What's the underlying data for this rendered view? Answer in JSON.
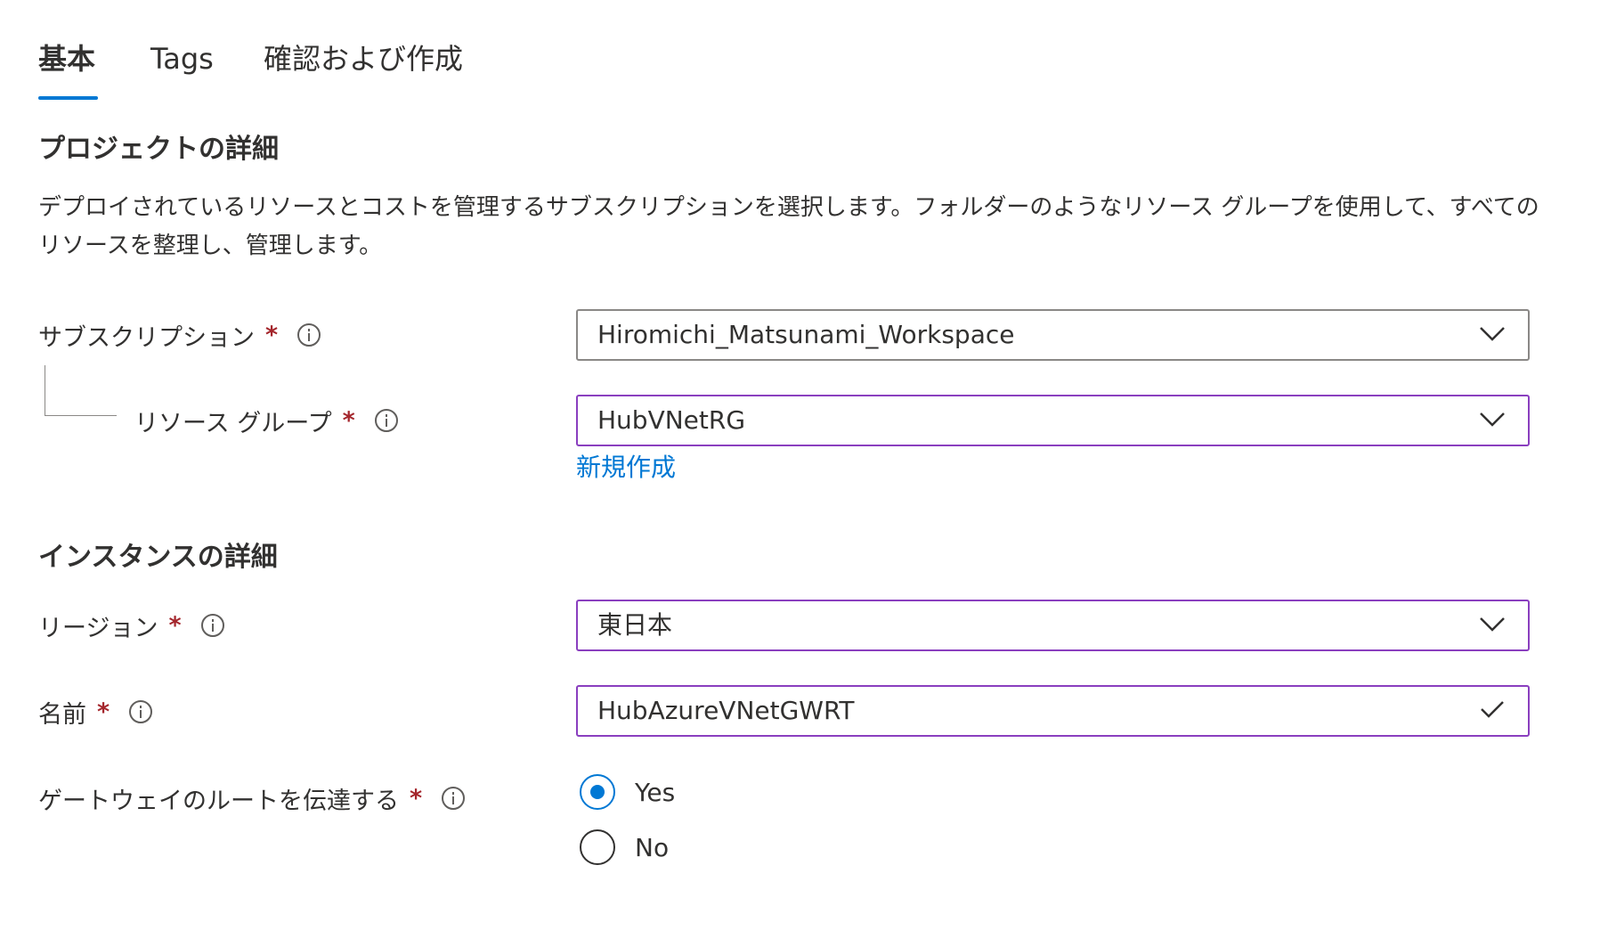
{
  "tabs": [
    {
      "label": "基本",
      "active": true
    },
    {
      "label": "Tags",
      "active": false
    },
    {
      "label": "確認および作成",
      "active": false
    }
  ],
  "project": {
    "title": "プロジェクトの詳細",
    "description": "デプロイされているリソースとコストを管理するサブスクリプションを選択します。フォルダーのようなリソース グループを使用して、すべてのリソースを整理し、管理します。",
    "subscription": {
      "label": "サブスクリプション",
      "required": "*",
      "value": "Hiromichi_Matsunami_Workspace"
    },
    "resource_group": {
      "label": "リソース グループ",
      "required": "*",
      "value": "HubVNetRG",
      "create_new_link": "新規作成"
    }
  },
  "instance": {
    "title": "インスタンスの詳細",
    "region": {
      "label": "リージョン",
      "required": "*",
      "value": "東日本"
    },
    "name": {
      "label": "名前",
      "required": "*",
      "value": "HubAzureVNetGWRT"
    },
    "propagate": {
      "label": "ゲートウェイのルートを伝達する",
      "required": "*",
      "options": [
        "Yes",
        "No"
      ],
      "selected": "Yes"
    }
  },
  "colors": {
    "accent": "#0078d4",
    "required": "#a4262c",
    "focus_border": "#8a3fbf"
  },
  "icons": {
    "info": "info-icon",
    "dropdown": "chevron-down-icon",
    "valid": "checkmark-icon"
  }
}
